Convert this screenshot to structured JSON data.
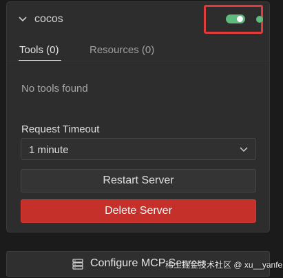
{
  "server": {
    "name": "cocos",
    "enabled": true,
    "status": "running",
    "status_color": "#5fba7d"
  },
  "tabs": [
    {
      "label": "Tools (0)",
      "active": true
    },
    {
      "label": "Resources (0)",
      "active": false
    }
  ],
  "tools": {
    "empty_message": "No tools found"
  },
  "timeout": {
    "label": "Request Timeout",
    "value": "1 minute"
  },
  "buttons": {
    "restart": "Restart Server",
    "delete": "Delete Server",
    "configure": "Configure MCP Servers"
  },
  "watermark": "稀土掘金技术社区 @ xu__yanfeng",
  "colors": {
    "accent_green": "#5fba7d",
    "danger": "#c6302b",
    "highlight": "#e03c3c"
  },
  "icons": {
    "chevron": "chevron-down-icon",
    "select": "chevron-down-icon",
    "configure": "server-icon"
  }
}
